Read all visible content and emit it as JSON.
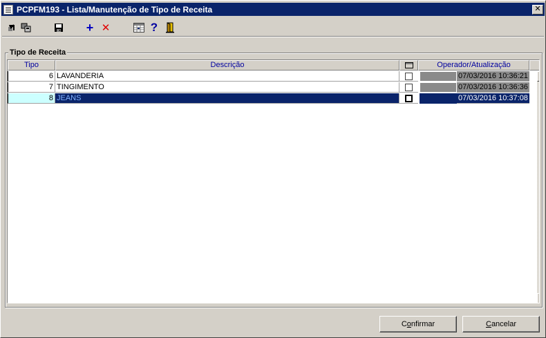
{
  "window": {
    "title": "PCPFM193 - Lista/Manutenção de Tipo de Receita",
    "close_glyph": "✕"
  },
  "toolbar": {
    "icons": [
      "navigate-in-icon",
      "copy-records-icon",
      "save-icon",
      "add-icon",
      "delete-icon",
      "grid-view-icon",
      "help-icon",
      "exit-door-icon"
    ],
    "add_glyph": "+",
    "delete_glyph": "✕",
    "help_glyph": "?"
  },
  "group": {
    "label": "Tipo de Receita"
  },
  "grid": {
    "headers": {
      "tipo": "Tipo",
      "descricao": "Descrição",
      "operador": "Operador/Atualização"
    },
    "rows": [
      {
        "tipo": "6",
        "descricao": "LAVANDERIA",
        "operador": "",
        "atualizacao": "07/03/2016 10:36:21",
        "selected": false
      },
      {
        "tipo": "7",
        "descricao": "TINGIMENTO",
        "operador": "",
        "atualizacao": "07/03/2016 10:36:36",
        "selected": false
      },
      {
        "tipo": "8",
        "descricao": "JEANS",
        "operador": "",
        "atualizacao": "07/03/2016 10:37:08",
        "selected": true
      }
    ]
  },
  "buttons": {
    "confirm_first": "C",
    "confirm_ul": "o",
    "confirm_rest": "nfirmar",
    "cancel_ul": "C",
    "cancel_rest": "ancelar"
  },
  "colors": {
    "selection": "#0a246a",
    "header_text": "#0000a0",
    "face": "#d4d0c8"
  }
}
